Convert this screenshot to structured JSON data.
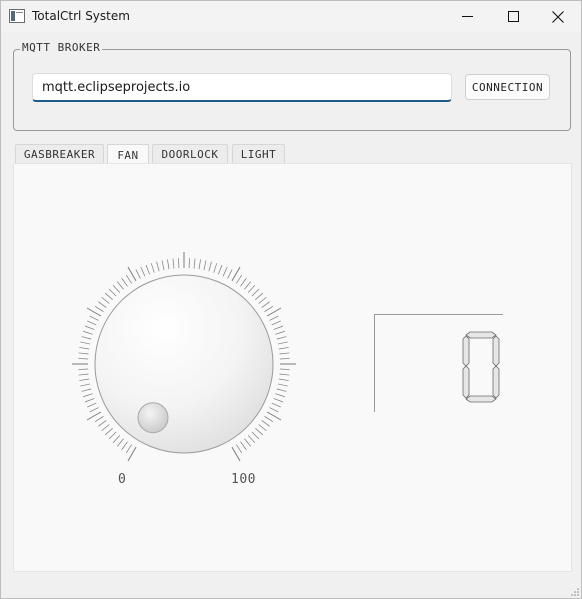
{
  "window": {
    "title": "TotalCtrl System",
    "controls": {
      "minimize": "minimize-icon",
      "maximize": "maximize-icon",
      "close": "close-icon"
    }
  },
  "broker": {
    "group_title": "MQTT BROKER",
    "input_value": "mqtt.eclipseprojects.io",
    "connect_label": "CONNECTION"
  },
  "tabs": [
    {
      "label": "GASBREAKER",
      "active": false
    },
    {
      "label": "FAN",
      "active": true
    },
    {
      "label": "DOORLOCK",
      "active": false
    },
    {
      "label": "LIGHT",
      "active": false
    }
  ],
  "fan": {
    "dial": {
      "min_label": "0",
      "max_label": "100",
      "value": 0
    },
    "display_value": "0"
  },
  "colors": {
    "accent": "#1d5a86",
    "frame": "#9a9a9a"
  }
}
